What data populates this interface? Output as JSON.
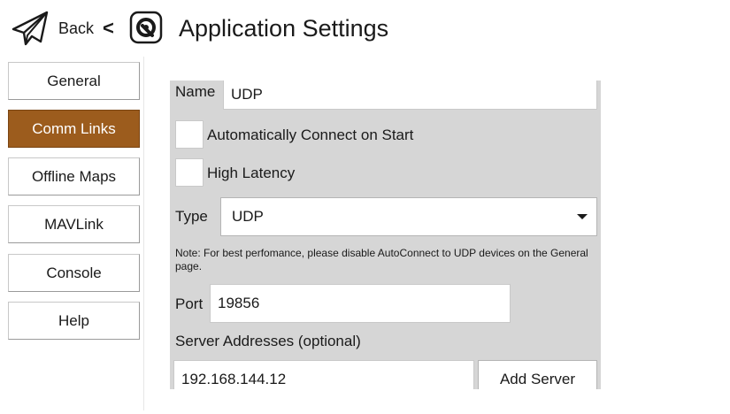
{
  "header": {
    "back_label": "Back",
    "back_chevron": "<",
    "title": "Application Settings",
    "back_icon": "paper-plane-icon",
    "logo_icon": "app-logo-icon"
  },
  "sidebar": {
    "items": [
      {
        "label": "General",
        "active": false
      },
      {
        "label": "Comm Links",
        "active": true
      },
      {
        "label": "Offline Maps",
        "active": false
      },
      {
        "label": "MAVLink",
        "active": false
      },
      {
        "label": "Console",
        "active": false
      },
      {
        "label": "Help",
        "active": false
      }
    ]
  },
  "form": {
    "name_label": "Name",
    "name_value": "UDP",
    "auto_connect_label": "Automatically Connect on Start",
    "auto_connect_checked": false,
    "high_latency_label": "High Latency",
    "high_latency_checked": false,
    "type_label": "Type",
    "type_value": "UDP",
    "note": "Note: For best perfomance, please disable AutoConnect to UDP devices on the General page.",
    "port_label": "Port",
    "port_value": "19856",
    "server_label": "Server Addresses (optional)",
    "server_value": "192.168.144.12",
    "add_server_label": "Add Server"
  },
  "colors": {
    "accent": "#9c5c1d",
    "panel_bg": "#d6d6d6",
    "field_bg": "#ffffff"
  }
}
